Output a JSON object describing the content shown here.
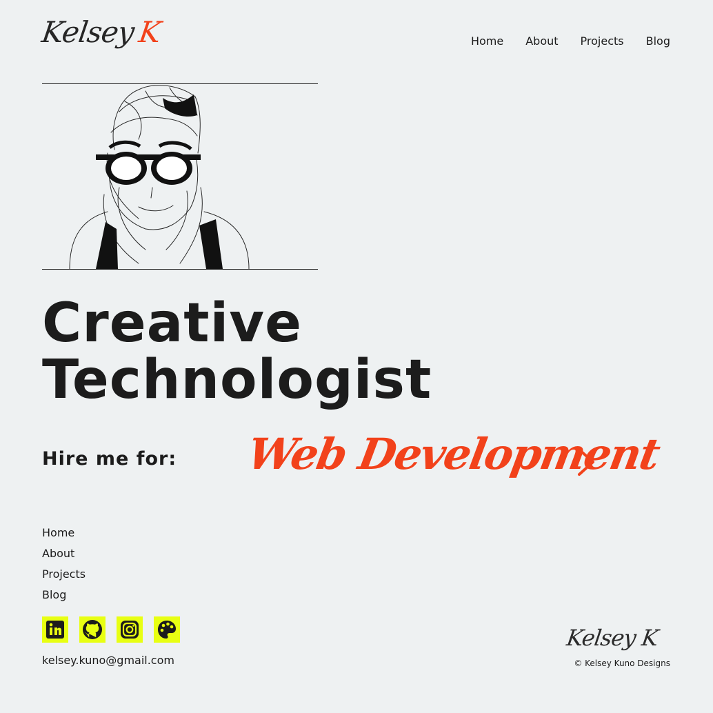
{
  "header": {
    "logo_first": "Kelsey",
    "logo_last": "K",
    "nav": [
      "Home",
      "About",
      "Projects",
      "Blog"
    ]
  },
  "hero": {
    "portrait_alt": "illustration-of-person-with-glasses",
    "headline_line1": "Creative",
    "headline_line2": "Technologist"
  },
  "hire": {
    "label": "Hire me for:",
    "service": "Web Development",
    "next_icon": "chevron-right-icon"
  },
  "footer": {
    "nav": [
      "Home",
      "About",
      "Projects",
      "Blog"
    ],
    "socials": [
      "linkedin-icon",
      "github-icon",
      "instagram-icon",
      "palette-icon"
    ],
    "email": "kelsey.kuno@gmail.com",
    "logo": "Kelsey K",
    "copyright": "© Kelsey Kuno Designs"
  },
  "colors": {
    "background": "#eef1f2",
    "text": "#1c1c1c",
    "accent": "#f2421b",
    "social_bg": "#e8ff12"
  }
}
